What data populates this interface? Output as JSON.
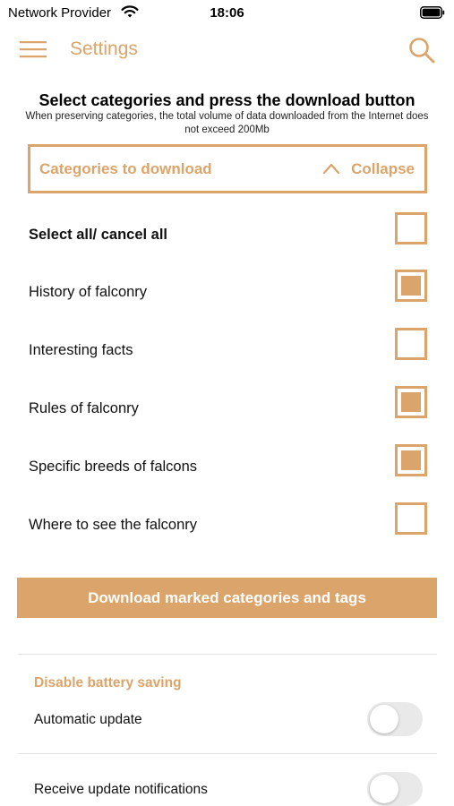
{
  "status_bar": {
    "carrier": "Network Provider",
    "time": "18:06",
    "wifi_icon": "wifi-icon",
    "battery_icon": "battery-icon"
  },
  "nav": {
    "title": "Settings",
    "menu_icon": "hamburger-menu-icon",
    "search_icon": "search-icon"
  },
  "intro": {
    "heading": "Select categories and press the download button",
    "subheading": "When preserving categories, the total volume of data downloaded from the Internet does not exceed  200Mb"
  },
  "categories_panel": {
    "title": "Categories to download",
    "collapse_label": "Collapse",
    "collapse_icon": "chevron-up-icon"
  },
  "categories": [
    {
      "label": "Select all/ cancel all",
      "checked": false,
      "bold": true
    },
    {
      "label": "History of falconry",
      "checked": true,
      "bold": false
    },
    {
      "label": "Interesting facts",
      "checked": false,
      "bold": false
    },
    {
      "label": "Rules of falconry",
      "checked": true,
      "bold": false
    },
    {
      "label": "Specific breeds of falcons",
      "checked": true,
      "bold": false
    },
    {
      "label": "Where to see the falconry",
      "checked": false,
      "bold": false
    }
  ],
  "download_button": {
    "label": "Download marked categories and tags"
  },
  "battery_section": {
    "title": "Disable battery saving",
    "toggles": [
      {
        "label": "Automatic update",
        "on": false
      },
      {
        "label": "Receive update notifications",
        "on": false
      }
    ]
  },
  "colors": {
    "accent": "#dba46a",
    "toggle_off": "#e9e9ea"
  }
}
